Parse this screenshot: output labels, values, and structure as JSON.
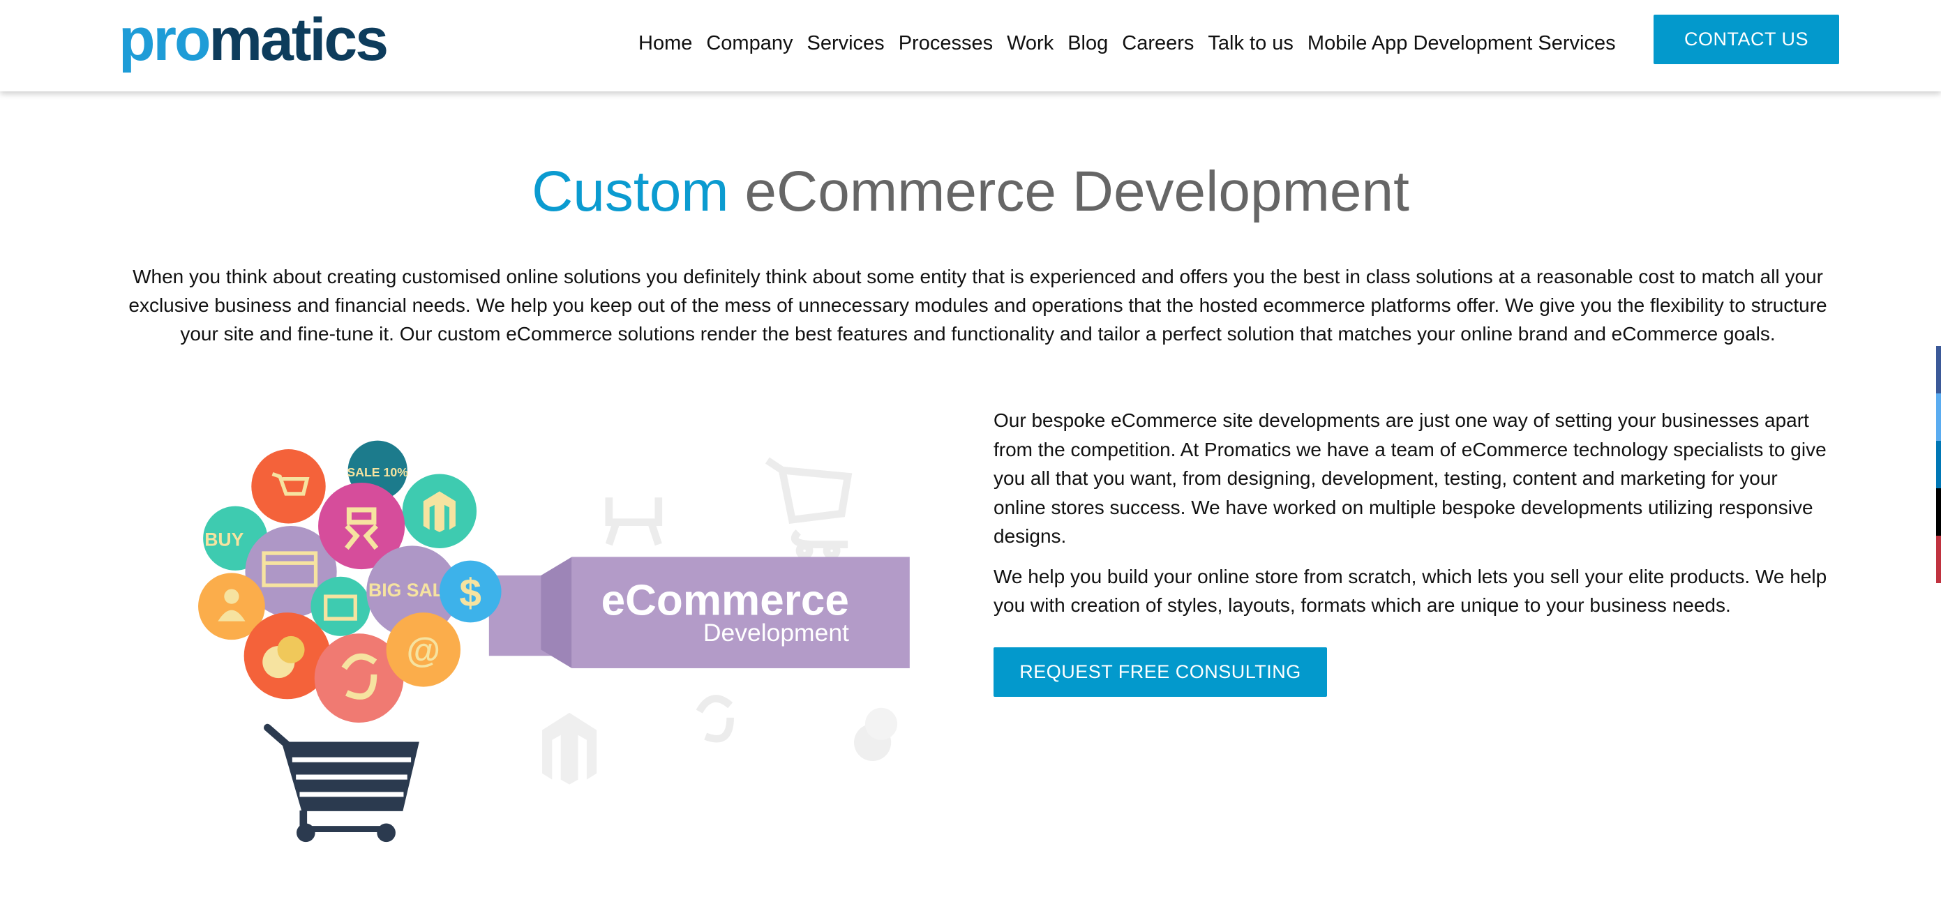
{
  "colors": {
    "accent": "#0399cc",
    "logo_pro": "#1e9cd7",
    "logo_matics": "#0d3c5c",
    "banner": "#b39bc8"
  },
  "header": {
    "logo": {
      "part1": "pro",
      "part2": "matics"
    },
    "nav": [
      "Home",
      "Company",
      "Services",
      "Processes",
      "Work",
      "Blog",
      "Careers",
      "Talk to us",
      "Mobile App Development Services"
    ],
    "contact_label": "CONTACT US"
  },
  "main": {
    "title_accent": "Custom",
    "title_rest": " eCommerce Development",
    "intro": "When you think about creating customised online solutions you definitely think about some entity that is experienced and offers you the best in class solutions at a reasonable cost to match all your exclusive business and financial needs. We help you keep out of the mess of unnecessary modules and operations that the hosted ecommerce platforms offer. We give you the flexibility to structure your site and fine-tune it. Our custom eCommerce solutions render the best features and functionality and tailor a perfect solution that matches your online brand and eCommerce goals.",
    "illustration": {
      "banner_title": "eCommerce",
      "banner_subtitle": "Development",
      "bubbles": [
        "BUY",
        "SALE 10%",
        "BIG SALE",
        "$",
        "@"
      ]
    },
    "paragraphs": [
      "Our bespoke eCommerce site developments are just one way of setting your businesses apart from the competition. At Promatics we have a team of eCommerce technology specialists to give you all that you want, from designing, development, testing, content and marketing for your online stores success. We have worked on multiple bespoke developments utilizing responsive designs.",
      "We help you build your online store from scratch, which lets you sell your elite products. We help you with creation of styles, layouts, formats which are unique to your business needs."
    ],
    "consult_label": "REQUEST FREE CONSULTING"
  },
  "social": [
    {
      "icon": "facebook-icon",
      "color": "#3b5998"
    },
    {
      "icon": "twitter-icon",
      "color": "#5aacf0"
    },
    {
      "icon": "linkedin-icon",
      "color": "#0077b5"
    },
    {
      "icon": "tumblr-icon",
      "color": "#000000"
    },
    {
      "icon": "pinterest-icon",
      "color": "#c0323f"
    }
  ]
}
